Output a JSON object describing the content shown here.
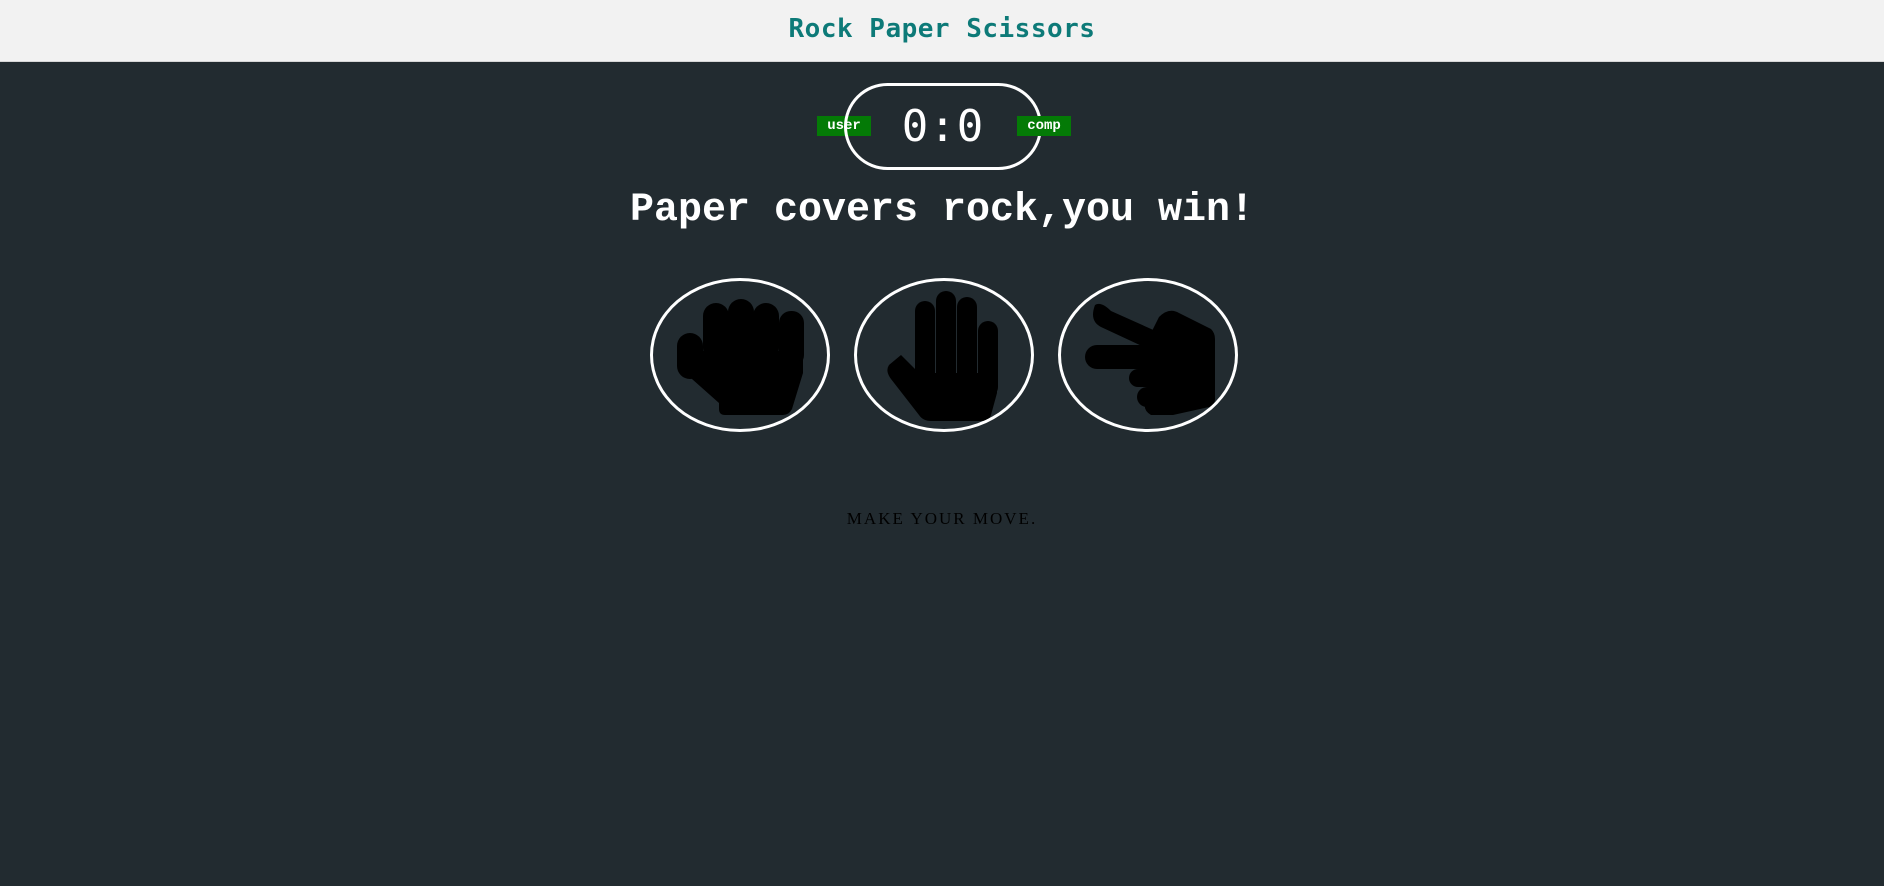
{
  "header": {
    "title": "Rock Paper Scissors"
  },
  "scoreboard": {
    "user_label": "user",
    "comp_label": "comp",
    "score_text": "0:0",
    "user_score": 0,
    "comp_score": 0,
    "badge_color": "#047a06"
  },
  "result": {
    "message": "Paper covers rock,you win!"
  },
  "choices": [
    {
      "id": "rock",
      "icon": "fist-icon"
    },
    {
      "id": "paper",
      "icon": "open-hand-icon"
    },
    {
      "id": "scissors",
      "icon": "scissors-hand-icon"
    }
  ],
  "action": {
    "message": "MAKE YOUR MOVE."
  },
  "colors": {
    "background": "#222b30",
    "header_background": "#f2f2f2",
    "title": "#0d7a78",
    "text": "#ffffff"
  }
}
